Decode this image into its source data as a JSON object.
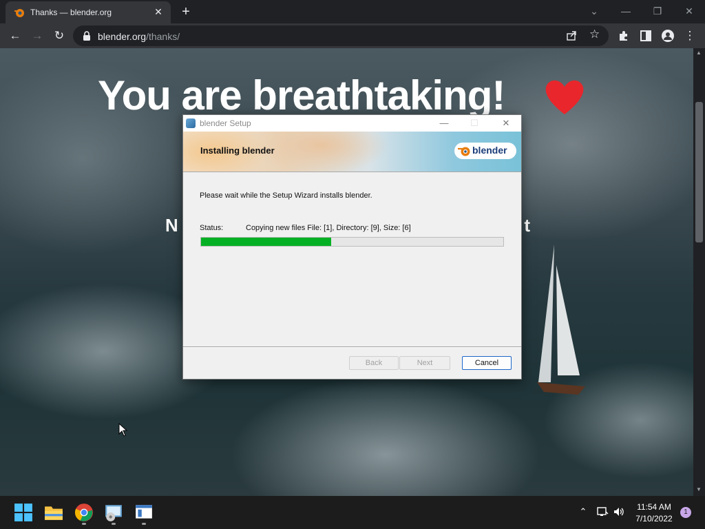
{
  "browser": {
    "tab": {
      "title": "Thanks — blender.org",
      "close_icon": "close-icon"
    },
    "new_tab_icon": "plus-icon",
    "window_controls": [
      "chevron-down-icon",
      "minimize-icon",
      "restore-icon",
      "close-icon"
    ],
    "url": {
      "host": "blender.org",
      "path": "/thanks/"
    }
  },
  "page": {
    "headline": "You are breathtaking!",
    "subline_left": "N",
    "subline_right": "t"
  },
  "setup_dialog": {
    "title": "blender Setup",
    "banner_title": "Installing blender",
    "logo_text": "blender",
    "wait_text": "Please wait while the Setup Wizard installs blender.",
    "status_label": "Status:",
    "status_value": "Copying new files File: [1],  Directory: [9],  Size: [6]",
    "progress": 0.43,
    "buttons": {
      "back": "Back",
      "next": "Next",
      "cancel": "Cancel"
    }
  },
  "taskbar": {
    "apps": [
      "windows-start-icon",
      "file-explorer-icon",
      "chrome-icon",
      "installer-icon",
      "setup-window-icon"
    ],
    "clock": {
      "time": "11:54 AM",
      "date": "7/10/2022"
    },
    "notification_count": "1"
  },
  "colors": {
    "progress_fill": "#06b025",
    "heart": "#e8262b",
    "cancel_border": "#1b66c9"
  }
}
